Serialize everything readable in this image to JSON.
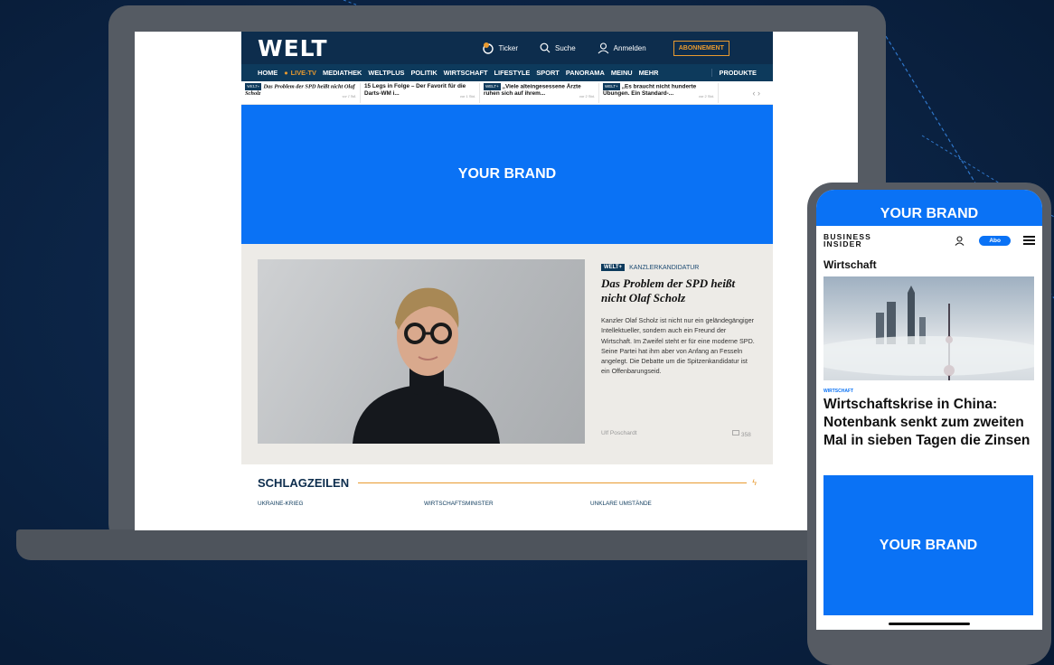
{
  "welt": {
    "logo": "WELT",
    "topbar": {
      "ticker": "Ticker",
      "search": "Suche",
      "login": "Anmelden",
      "subscribe": "ABONNEMENT"
    },
    "nav": [
      "HOME",
      "LIVE-TV",
      "MEDIATHEK",
      "WELTPLUS",
      "POLITIK",
      "WIRTSCHAFT",
      "LIFESTYLE",
      "SPORT",
      "PANORAMA",
      "MEINU",
      "MEHR",
      "PRODUKTE"
    ],
    "news": [
      {
        "badge": "WELT+",
        "title": "Das Problem der SPD heißt nicht Olaf Scholz",
        "time": "vor 1 Std."
      },
      {
        "badge": "",
        "title": "15 Legs in Folge – Der Favorit für die Darts-WM i...",
        "time": "vor 1 Std."
      },
      {
        "badge": "WELT+",
        "title": "„Viele alteingesessene Ärzte ruhen sich auf ihrem...",
        "time": "vor 2 Std."
      },
      {
        "badge": "WELT+",
        "title": "„Es braucht nicht hunderte Übungen. Ein Standard-...",
        "time": "vor 2 Std."
      }
    ],
    "news_arrows": "‹   ›",
    "brand_banner": "YOUR BRAND",
    "feature": {
      "badge": "WELT+",
      "kicker": "KANZLERKANDIDATUR",
      "headline": "Das Problem der SPD heißt nicht Olaf Scholz",
      "teaser": "Kanzler Olaf Scholz ist nicht nur ein geländegängiger Intellektueller, sondern auch ein Freund der Wirtschaft. Im Zweifel steht er für eine moderne SPD. Seine Partei hat ihm aber von Anfang an Fesseln angelegt. Die Debatte um die Spitzenkandidatur ist ein Offenbarungseid.",
      "author": "Ulf Poschardt",
      "comments": "358"
    },
    "schlagzeilen": {
      "title": "SCHLAGZEILEN",
      "categories": [
        "UKRAINE-KRIEG",
        "WIRTSCHAFTSMINISTER",
        "UNKLARE UMSTÄNDE"
      ]
    }
  },
  "phone": {
    "brand_top": "YOUR BRAND",
    "logo_line1": "BUSINESS",
    "logo_line2": "INSIDER",
    "abo": "Abo",
    "section": "Wirtschaft",
    "kicker": "WIRTSCHAFT",
    "headline": "Wirtschaftskrise in China: Notenbank senkt zum zweiten Mal in sieben Tagen die Zinsen",
    "brand_bottom": "YOUR BRAND"
  },
  "colors": {
    "brand_blue": "#0a72f5",
    "welt_navy": "#0d2d4d",
    "welt_orange": "#e89a2f",
    "background": "#0c2547"
  },
  "icons": [
    "ticker-icon",
    "search-icon",
    "user-icon",
    "comment-icon",
    "lightning-icon",
    "menu-icon"
  ]
}
